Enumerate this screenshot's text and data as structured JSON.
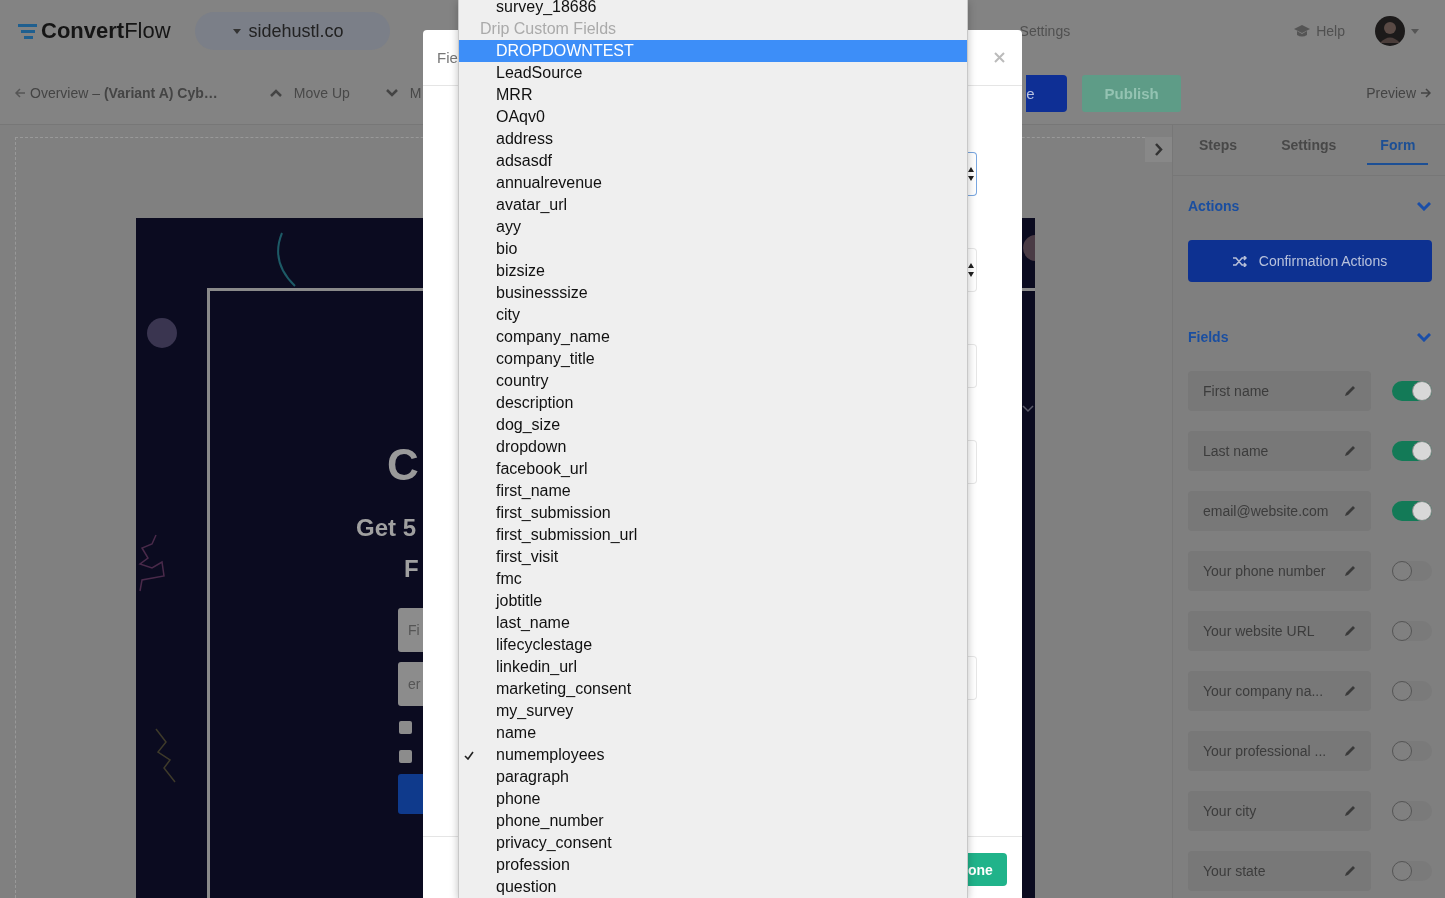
{
  "header": {
    "logo": "**Convert**Flow",
    "site_selector": "sidehustl.co",
    "settings": "Settings",
    "help": "Help"
  },
  "toolbar": {
    "breadcrumb": "Overview – **(Variant A) Cyb…**",
    "move_up": "Move Up",
    "move_down": "M",
    "save": "e",
    "publish": "Publish",
    "preview": "Preview"
  },
  "canvas": {
    "heading": "C",
    "subheading_1": "Get 5",
    "subheading_2": "F",
    "inputs": [
      {
        "placeholder": "Fi"
      },
      {
        "placeholder": "er"
      }
    ],
    "checkboxes": [
      {
        "checked": false
      },
      {
        "checked": false
      }
    ]
  },
  "panel": {
    "tabs": [
      {
        "label": "Steps",
        "selected": false
      },
      {
        "label": "Settings",
        "selected": false
      },
      {
        "label": "Form",
        "selected": true
      }
    ],
    "actions": {
      "title": "Actions",
      "expanded": true,
      "button": "Confirmation Actions"
    },
    "fields": {
      "title": "Fields",
      "expanded": true,
      "items": [
        {
          "label": "First name",
          "on": true
        },
        {
          "label": "Last name",
          "on": true
        },
        {
          "label": "email@website.com",
          "on": true
        },
        {
          "label": "Your phone number",
          "on": false
        },
        {
          "label": "Your website URL",
          "on": false
        },
        {
          "label": "Your company na...",
          "on": false
        },
        {
          "label": "Your professional ...",
          "on": false
        },
        {
          "label": "Your city",
          "on": false
        },
        {
          "label": "Your state",
          "on": false
        }
      ]
    }
  },
  "modal": {
    "title": "Fie",
    "done_button": "one"
  },
  "dropdown": {
    "options": [
      {
        "label": "survey_18686",
        "kind": "option",
        "selected": false,
        "checked": false
      },
      {
        "label": "Drip Custom Fields",
        "kind": "group"
      },
      {
        "label": "DROPDOWNTEST",
        "kind": "option",
        "selected": true,
        "checked": false
      },
      {
        "label": "LeadSource",
        "kind": "option",
        "selected": false,
        "checked": false
      },
      {
        "label": "MRR",
        "kind": "option",
        "selected": false,
        "checked": false
      },
      {
        "label": "OAqv0",
        "kind": "option",
        "selected": false,
        "checked": false
      },
      {
        "label": "address",
        "kind": "option",
        "selected": false,
        "checked": false
      },
      {
        "label": "adsasdf",
        "kind": "option",
        "selected": false,
        "checked": false
      },
      {
        "label": "annualrevenue",
        "kind": "option",
        "selected": false,
        "checked": false
      },
      {
        "label": "avatar_url",
        "kind": "option",
        "selected": false,
        "checked": false
      },
      {
        "label": "ayy",
        "kind": "option",
        "selected": false,
        "checked": false
      },
      {
        "label": "bio",
        "kind": "option",
        "selected": false,
        "checked": false
      },
      {
        "label": "bizsize",
        "kind": "option",
        "selected": false,
        "checked": false
      },
      {
        "label": "businesssize",
        "kind": "option",
        "selected": false,
        "checked": false
      },
      {
        "label": "city",
        "kind": "option",
        "selected": false,
        "checked": false
      },
      {
        "label": "company_name",
        "kind": "option",
        "selected": false,
        "checked": false
      },
      {
        "label": "company_title",
        "kind": "option",
        "selected": false,
        "checked": false
      },
      {
        "label": "country",
        "kind": "option",
        "selected": false,
        "checked": false
      },
      {
        "label": "description",
        "kind": "option",
        "selected": false,
        "checked": false
      },
      {
        "label": "dog_size",
        "kind": "option",
        "selected": false,
        "checked": false
      },
      {
        "label": "dropdown",
        "kind": "option",
        "selected": false,
        "checked": false
      },
      {
        "label": "facebook_url",
        "kind": "option",
        "selected": false,
        "checked": false
      },
      {
        "label": "first_name",
        "kind": "option",
        "selected": false,
        "checked": false
      },
      {
        "label": "first_submission",
        "kind": "option",
        "selected": false,
        "checked": false
      },
      {
        "label": "first_submission_url",
        "kind": "option",
        "selected": false,
        "checked": false
      },
      {
        "label": "first_visit",
        "kind": "option",
        "selected": false,
        "checked": false
      },
      {
        "label": "fmc",
        "kind": "option",
        "selected": false,
        "checked": false
      },
      {
        "label": "jobtitle",
        "kind": "option",
        "selected": false,
        "checked": false
      },
      {
        "label": "last_name",
        "kind": "option",
        "selected": false,
        "checked": false
      },
      {
        "label": "lifecyclestage",
        "kind": "option",
        "selected": false,
        "checked": false
      },
      {
        "label": "linkedin_url",
        "kind": "option",
        "selected": false,
        "checked": false
      },
      {
        "label": "marketing_consent",
        "kind": "option",
        "selected": false,
        "checked": false
      },
      {
        "label": "my_survey",
        "kind": "option",
        "selected": false,
        "checked": false
      },
      {
        "label": "name",
        "kind": "option",
        "selected": false,
        "checked": false
      },
      {
        "label": "numemployees",
        "kind": "option",
        "selected": false,
        "checked": true
      },
      {
        "label": "paragraph",
        "kind": "option",
        "selected": false,
        "checked": false
      },
      {
        "label": "phone",
        "kind": "option",
        "selected": false,
        "checked": false
      },
      {
        "label": "phone_number",
        "kind": "option",
        "selected": false,
        "checked": false
      },
      {
        "label": "privacy_consent",
        "kind": "option",
        "selected": false,
        "checked": false
      },
      {
        "label": "profession",
        "kind": "option",
        "selected": false,
        "checked": false
      },
      {
        "label": "question",
        "kind": "option",
        "selected": false,
        "checked": false
      }
    ]
  }
}
